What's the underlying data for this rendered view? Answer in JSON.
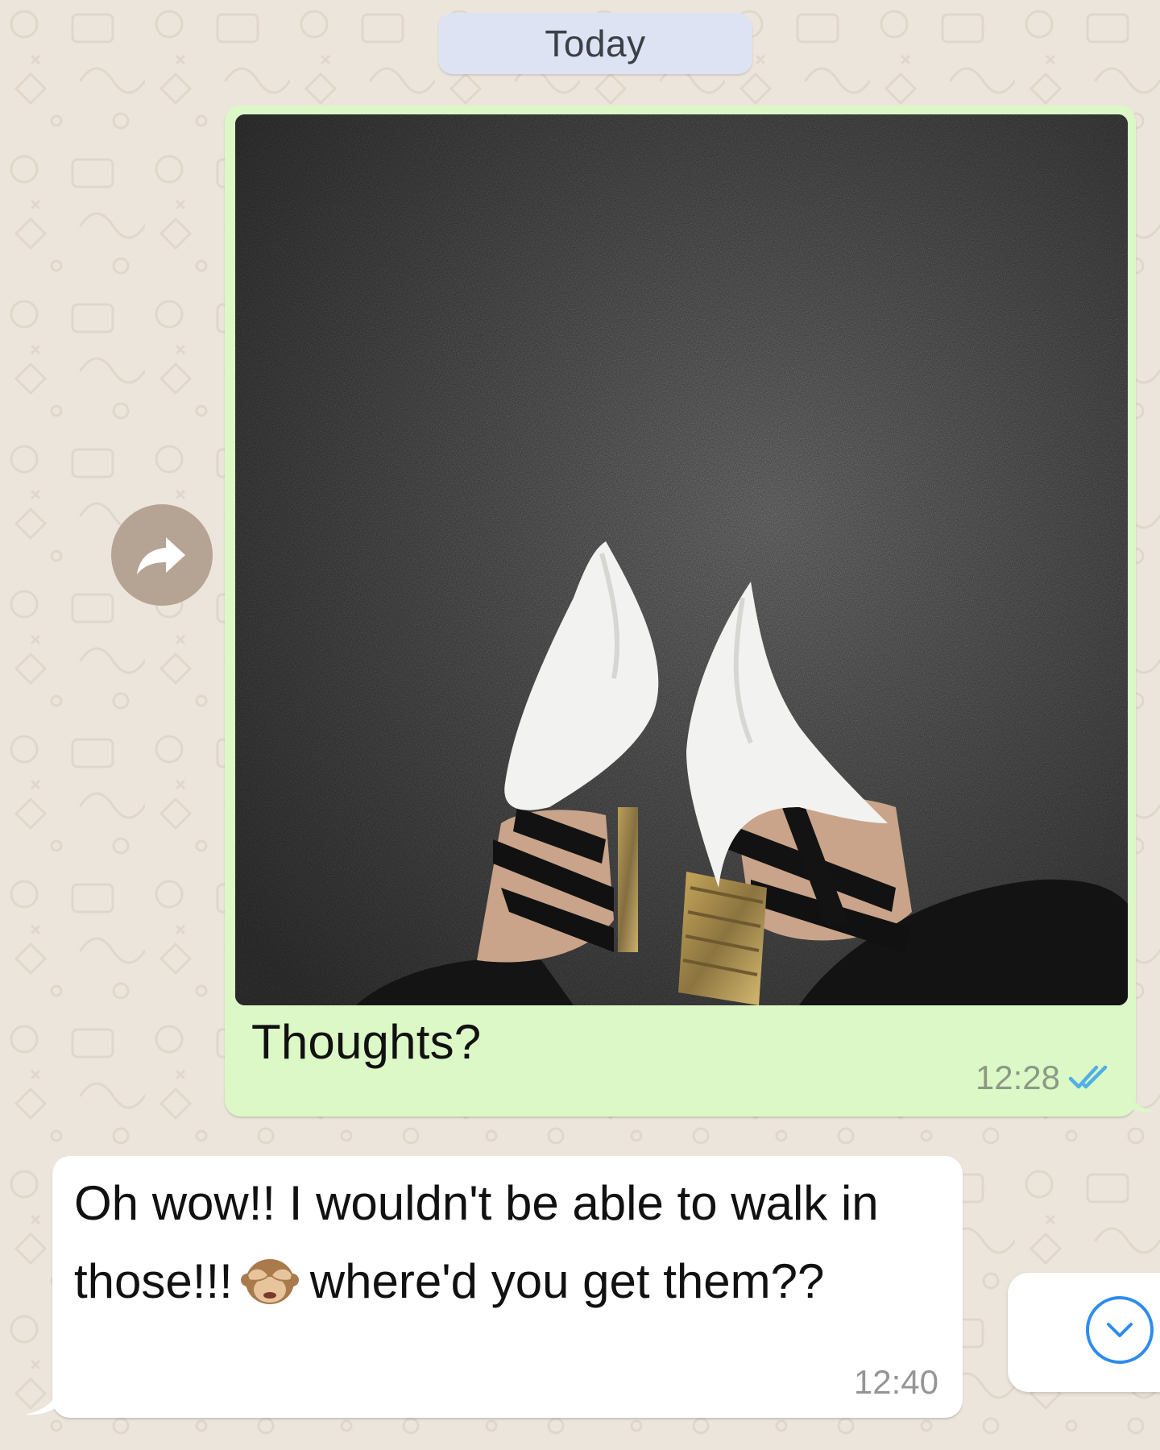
{
  "chat": {
    "date_separator": "Today",
    "outgoing": {
      "caption": "Thoughts?",
      "time": "12:28",
      "status_icon": "double-check-read-icon",
      "photo": "image-white-pointed-heels-on-dark-carpet"
    },
    "incoming": {
      "text_part1": "Oh wow!! I wouldn't be able to walk in those!!!",
      "emoji": "see-no-evil-monkey-emoji",
      "text_part2": "where'd you get them??",
      "time": "12:40"
    },
    "forward_button_icon": "forward-arrow-icon",
    "scroll_button_icon": "chevron-down-icon"
  },
  "colors": {
    "wallpaper": "#ece5dc",
    "outgoing_bubble": "#dcf8c6",
    "incoming_bubble": "#ffffff",
    "read_ticks": "#4fb0e6",
    "accent": "#2d8ced"
  }
}
